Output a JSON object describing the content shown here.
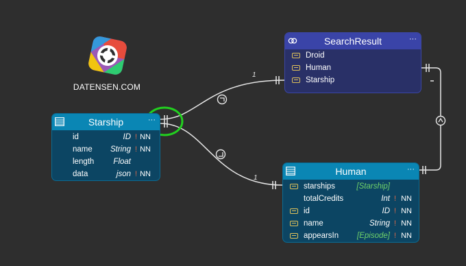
{
  "logo": {
    "text": "DATENSEN.COM",
    "colors": [
      "#e74c3c",
      "#f1c40f",
      "#2ecc71",
      "#3498db",
      "#9b59b6"
    ]
  },
  "accent": {
    "highlight_circle": "#22d11f",
    "line": "#e8e8e8"
  },
  "entities": {
    "starship": {
      "title": "Starship",
      "menu": "···",
      "fields": [
        {
          "name": "id",
          "type": "ID",
          "bang": "!",
          "nn": "NN"
        },
        {
          "name": "name",
          "type": "String",
          "bang": "!",
          "nn": "NN"
        },
        {
          "name": "length",
          "type": "Float",
          "bang": "",
          "nn": ""
        },
        {
          "name": "data",
          "type": "json",
          "bang": "!",
          "nn": "NN"
        }
      ]
    },
    "search_result": {
      "title": "SearchResult",
      "menu": "···",
      "fields": [
        {
          "name": "Droid"
        },
        {
          "name": "Human"
        },
        {
          "name": "Starship"
        }
      ]
    },
    "human": {
      "title": "Human",
      "menu": "···",
      "fields": [
        {
          "name": "starships",
          "type": "[Starship]",
          "bang": "",
          "nn": ""
        },
        {
          "name": "totalCredits",
          "type": "Int",
          "bang": "!",
          "nn": "NN"
        },
        {
          "name": "id",
          "type": "ID",
          "bang": "!",
          "nn": "NN"
        },
        {
          "name": "name",
          "type": "String",
          "bang": "!",
          "nn": "NN"
        },
        {
          "name": "appearsIn",
          "type": "[Episode]",
          "bang": "!",
          "nn": "NN"
        }
      ]
    }
  },
  "relations": {
    "label_search": "1",
    "label_human": "1"
  }
}
